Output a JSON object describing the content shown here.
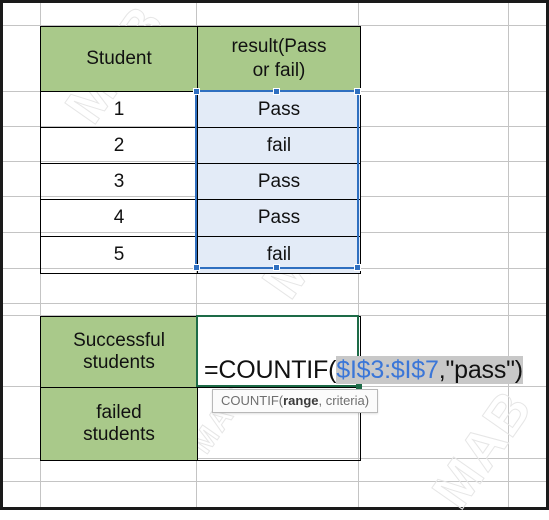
{
  "app": "excel-worksheet",
  "watermarks": [
    "MAB",
    "MAB",
    "MAB",
    "MAB"
  ],
  "data_table": {
    "headers": [
      "Student",
      "result(Pass or fail)"
    ],
    "header_line1": "result(Pass",
    "header_line2": "or fail)",
    "student_header": "Student",
    "rows": [
      {
        "student": "1",
        "result": "Pass"
      },
      {
        "student": "2",
        "result": "fail"
      },
      {
        "student": "3",
        "result": "Pass"
      },
      {
        "student": "4",
        "result": "Pass"
      },
      {
        "student": "5",
        "result": "fail"
      }
    ]
  },
  "summary_table": {
    "rows": [
      {
        "label_line1": "Successful",
        "label_line2": "students",
        "value": ""
      },
      {
        "label_line1": "failed",
        "label_line2": "students",
        "value": ""
      }
    ]
  },
  "formula": {
    "prefix": "=COUNTIF(",
    "range": "$I$3:$I$7",
    "suffix": ",\"pass\")",
    "full": "=COUNTIF($I$3:$I$7,\"pass\")"
  },
  "tooltip": {
    "func": "COUNTIF(",
    "arg1": "range",
    "arg2": ", criteria)"
  },
  "colors": {
    "header_green": "#a9c98a",
    "selection_blue": "#2f6fc0",
    "selection_fill": "#e3ebf7",
    "active_green": "#1d6b47",
    "range_ref_blue": "#3a76d8",
    "formula_highlight": "#c8c8c8",
    "gridline": "#c4c4c4"
  }
}
